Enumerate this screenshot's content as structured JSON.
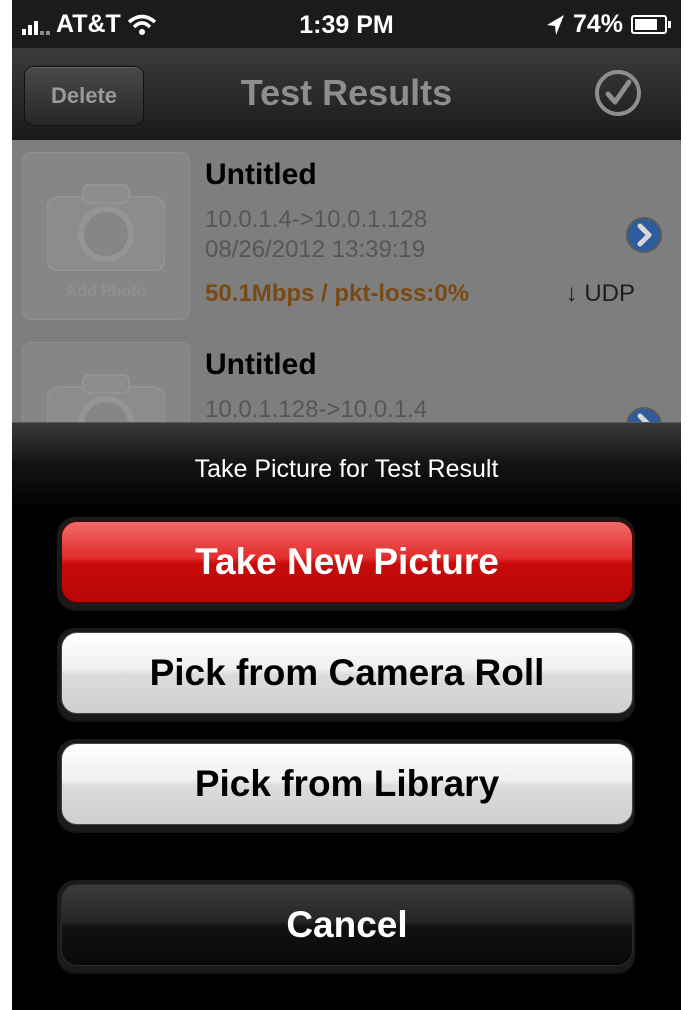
{
  "status_bar": {
    "carrier": "AT&T",
    "time": "1:39 PM",
    "battery": "74%",
    "icons": [
      "signal-bars-icon",
      "wifi-icon",
      "location-arrow-icon",
      "battery-icon"
    ]
  },
  "nav": {
    "delete_label": "Delete",
    "title": "Test Results",
    "done_icon": "checkmark-circle-icon"
  },
  "results": [
    {
      "thumb_label": "Add Photo",
      "title": "Untitled",
      "route": "10.0.1.4->10.0.1.128",
      "timestamp": "08/26/2012 13:39:19",
      "stats": "50.1Mbps / pkt-loss:0%",
      "protocol": "↓ UDP"
    },
    {
      "title": "Untitled",
      "route": "10.0.1.128->10.0.1.4"
    }
  ],
  "action_sheet": {
    "title": "Take Picture for Test Result",
    "take_new_label": "Take New Picture",
    "camera_roll_label": "Pick from Camera Roll",
    "library_label": "Pick from Library",
    "cancel_label": "Cancel"
  },
  "colors": {
    "destructive": "#d9191a",
    "stats_text": "#7a4a14",
    "disclosure": "#2e5d9e"
  }
}
